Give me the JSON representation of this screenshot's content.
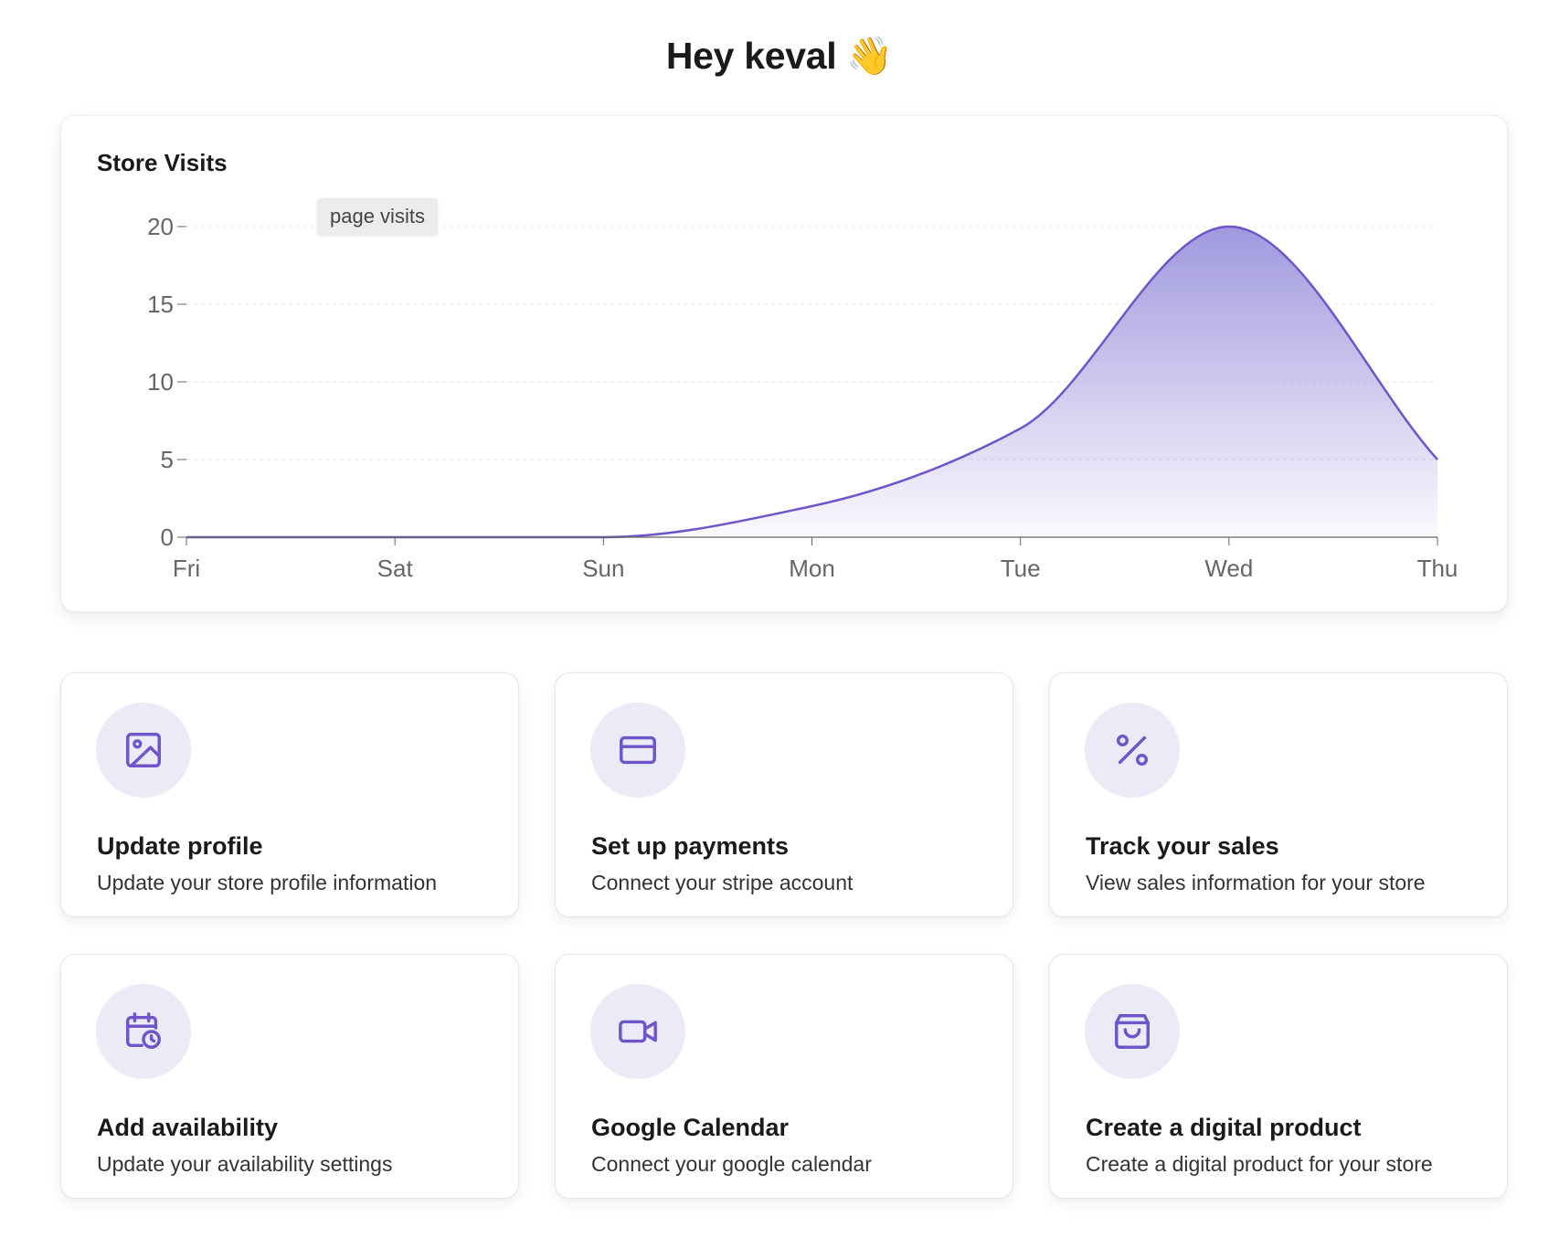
{
  "greeting": "Hey keval 👋",
  "chart_card": {
    "title": "Store Visits",
    "legend_label": "page visits"
  },
  "chart_data": {
    "type": "area",
    "title": "Store Visits",
    "categories": [
      "Fri",
      "Sat",
      "Sun",
      "Mon",
      "Tue",
      "Wed",
      "Thu"
    ],
    "series": [
      {
        "name": "page visits",
        "values": [
          0,
          0,
          0,
          2,
          7,
          20,
          5
        ]
      }
    ],
    "y_ticks": [
      0,
      5,
      10,
      15,
      20
    ],
    "ylim": [
      0,
      20
    ],
    "grid": true,
    "line_color": "#6f55c9",
    "fill_color": "#9b93dc"
  },
  "colors": {
    "accent": "#6f55c9",
    "icon_bg": "#ebebf8"
  },
  "cards": [
    {
      "title": "Update profile",
      "description": "Update your store profile information",
      "icon": "image-icon"
    },
    {
      "title": "Set up payments",
      "description": "Connect your stripe account",
      "icon": "credit-card-icon"
    },
    {
      "title": "Track your sales",
      "description": "View sales information for your store",
      "icon": "percent-icon"
    },
    {
      "title": "Add availability",
      "description": "Update your availability settings",
      "icon": "calendar-clock-icon"
    },
    {
      "title": "Google Calendar",
      "description": "Connect your google calendar",
      "icon": "video-camera-icon"
    },
    {
      "title": "Create a digital product",
      "description": "Create a digital product for your store",
      "icon": "shopping-bag-icon"
    }
  ]
}
